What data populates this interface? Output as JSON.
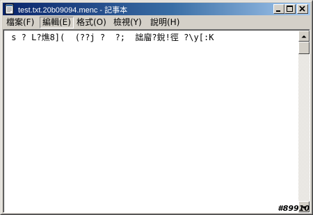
{
  "window": {
    "title": "test.txt.20b09094.menc - 記事本",
    "buttons": {
      "minimize": "minimize",
      "maximize": "maximize",
      "close": "close"
    }
  },
  "menubar": {
    "items": [
      {
        "label": "檔案(F)"
      },
      {
        "label": "編輯(E)"
      },
      {
        "label": "格式(O)"
      },
      {
        "label": "檢視(Y)"
      },
      {
        "label": "說明(H)"
      }
    ]
  },
  "editor": {
    "content": " s ? L?燋8](  (??j ?  ?;  詘廇?銳!徑 ?\\y[:K"
  },
  "icons": [
    "notepad-app-icon",
    "minimize-icon",
    "maximize-icon",
    "close-icon",
    "scroll-up-arrow-icon",
    "scroll-down-arrow-icon"
  ],
  "watermark": "#89910"
}
